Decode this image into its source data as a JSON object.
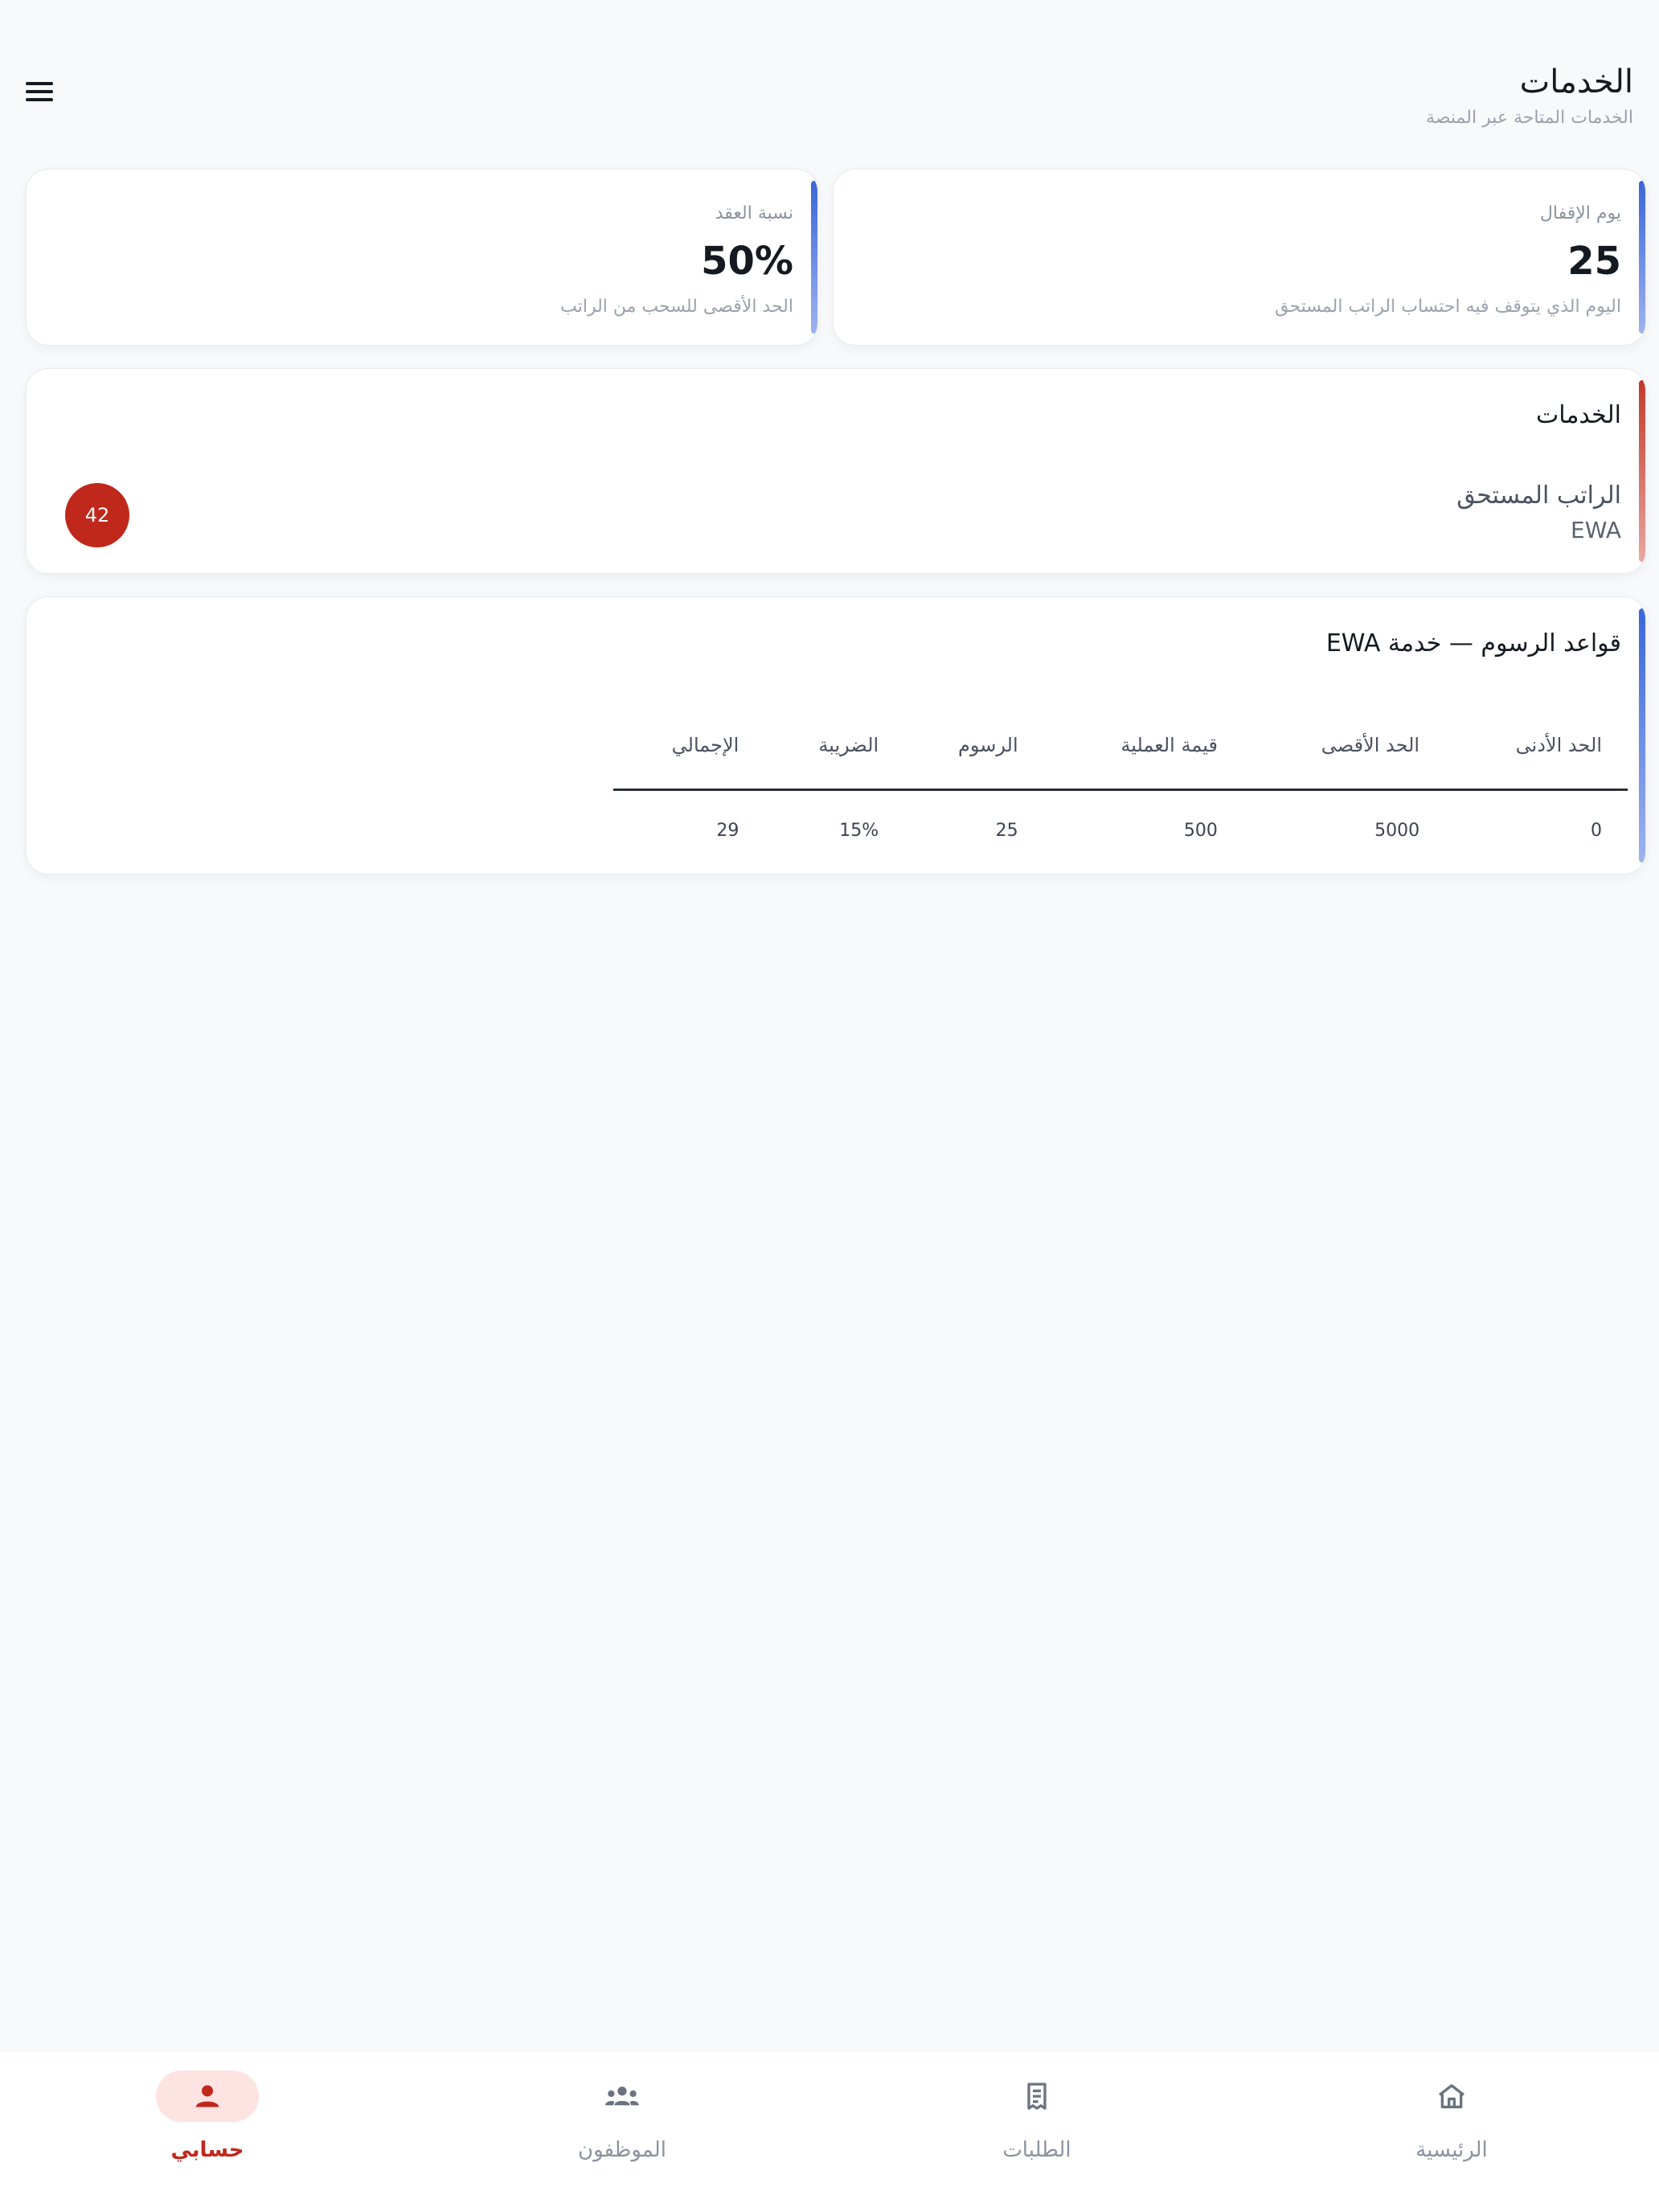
{
  "header": {
    "title": "الخدمات",
    "subtitle": "الخدمات المتاحة عبر المنصة"
  },
  "stats": [
    {
      "label": "يوم الإقفال",
      "value": "25",
      "note": "اليوم الذي يتوقف فيه احتساب الراتب المستحق"
    },
    {
      "label": "نسبة العقد",
      "value": "50%",
      "note": "الحد الأقصى للسحب من الراتب"
    }
  ],
  "services": {
    "title": "الخدمات",
    "item": {
      "name": "الراتب المستحق",
      "code": "EWA",
      "count": "42"
    }
  },
  "fees": {
    "title": "قواعد الرسوم — خدمة EWA",
    "columns": [
      "الحد الأدنى",
      "الحد الأقصى",
      "قيمة العملية",
      "الرسوم",
      "الضريبة",
      "الإجمالي"
    ],
    "rows": [
      [
        "0",
        "5000",
        "500",
        "25",
        "15%",
        "29"
      ]
    ]
  },
  "nav": {
    "items": [
      {
        "label": "الرئيسية",
        "icon": "home-icon"
      },
      {
        "label": "الطلبات",
        "icon": "receipt-icon"
      },
      {
        "label": "الموظفون",
        "icon": "group-icon"
      },
      {
        "label": "حسابي",
        "icon": "person-icon"
      }
    ],
    "active_index": 3
  },
  "colors": {
    "brand_red": "#c0281c",
    "accent_blue": "#3b66d8",
    "active_tab_bg": "#fde3e1"
  }
}
